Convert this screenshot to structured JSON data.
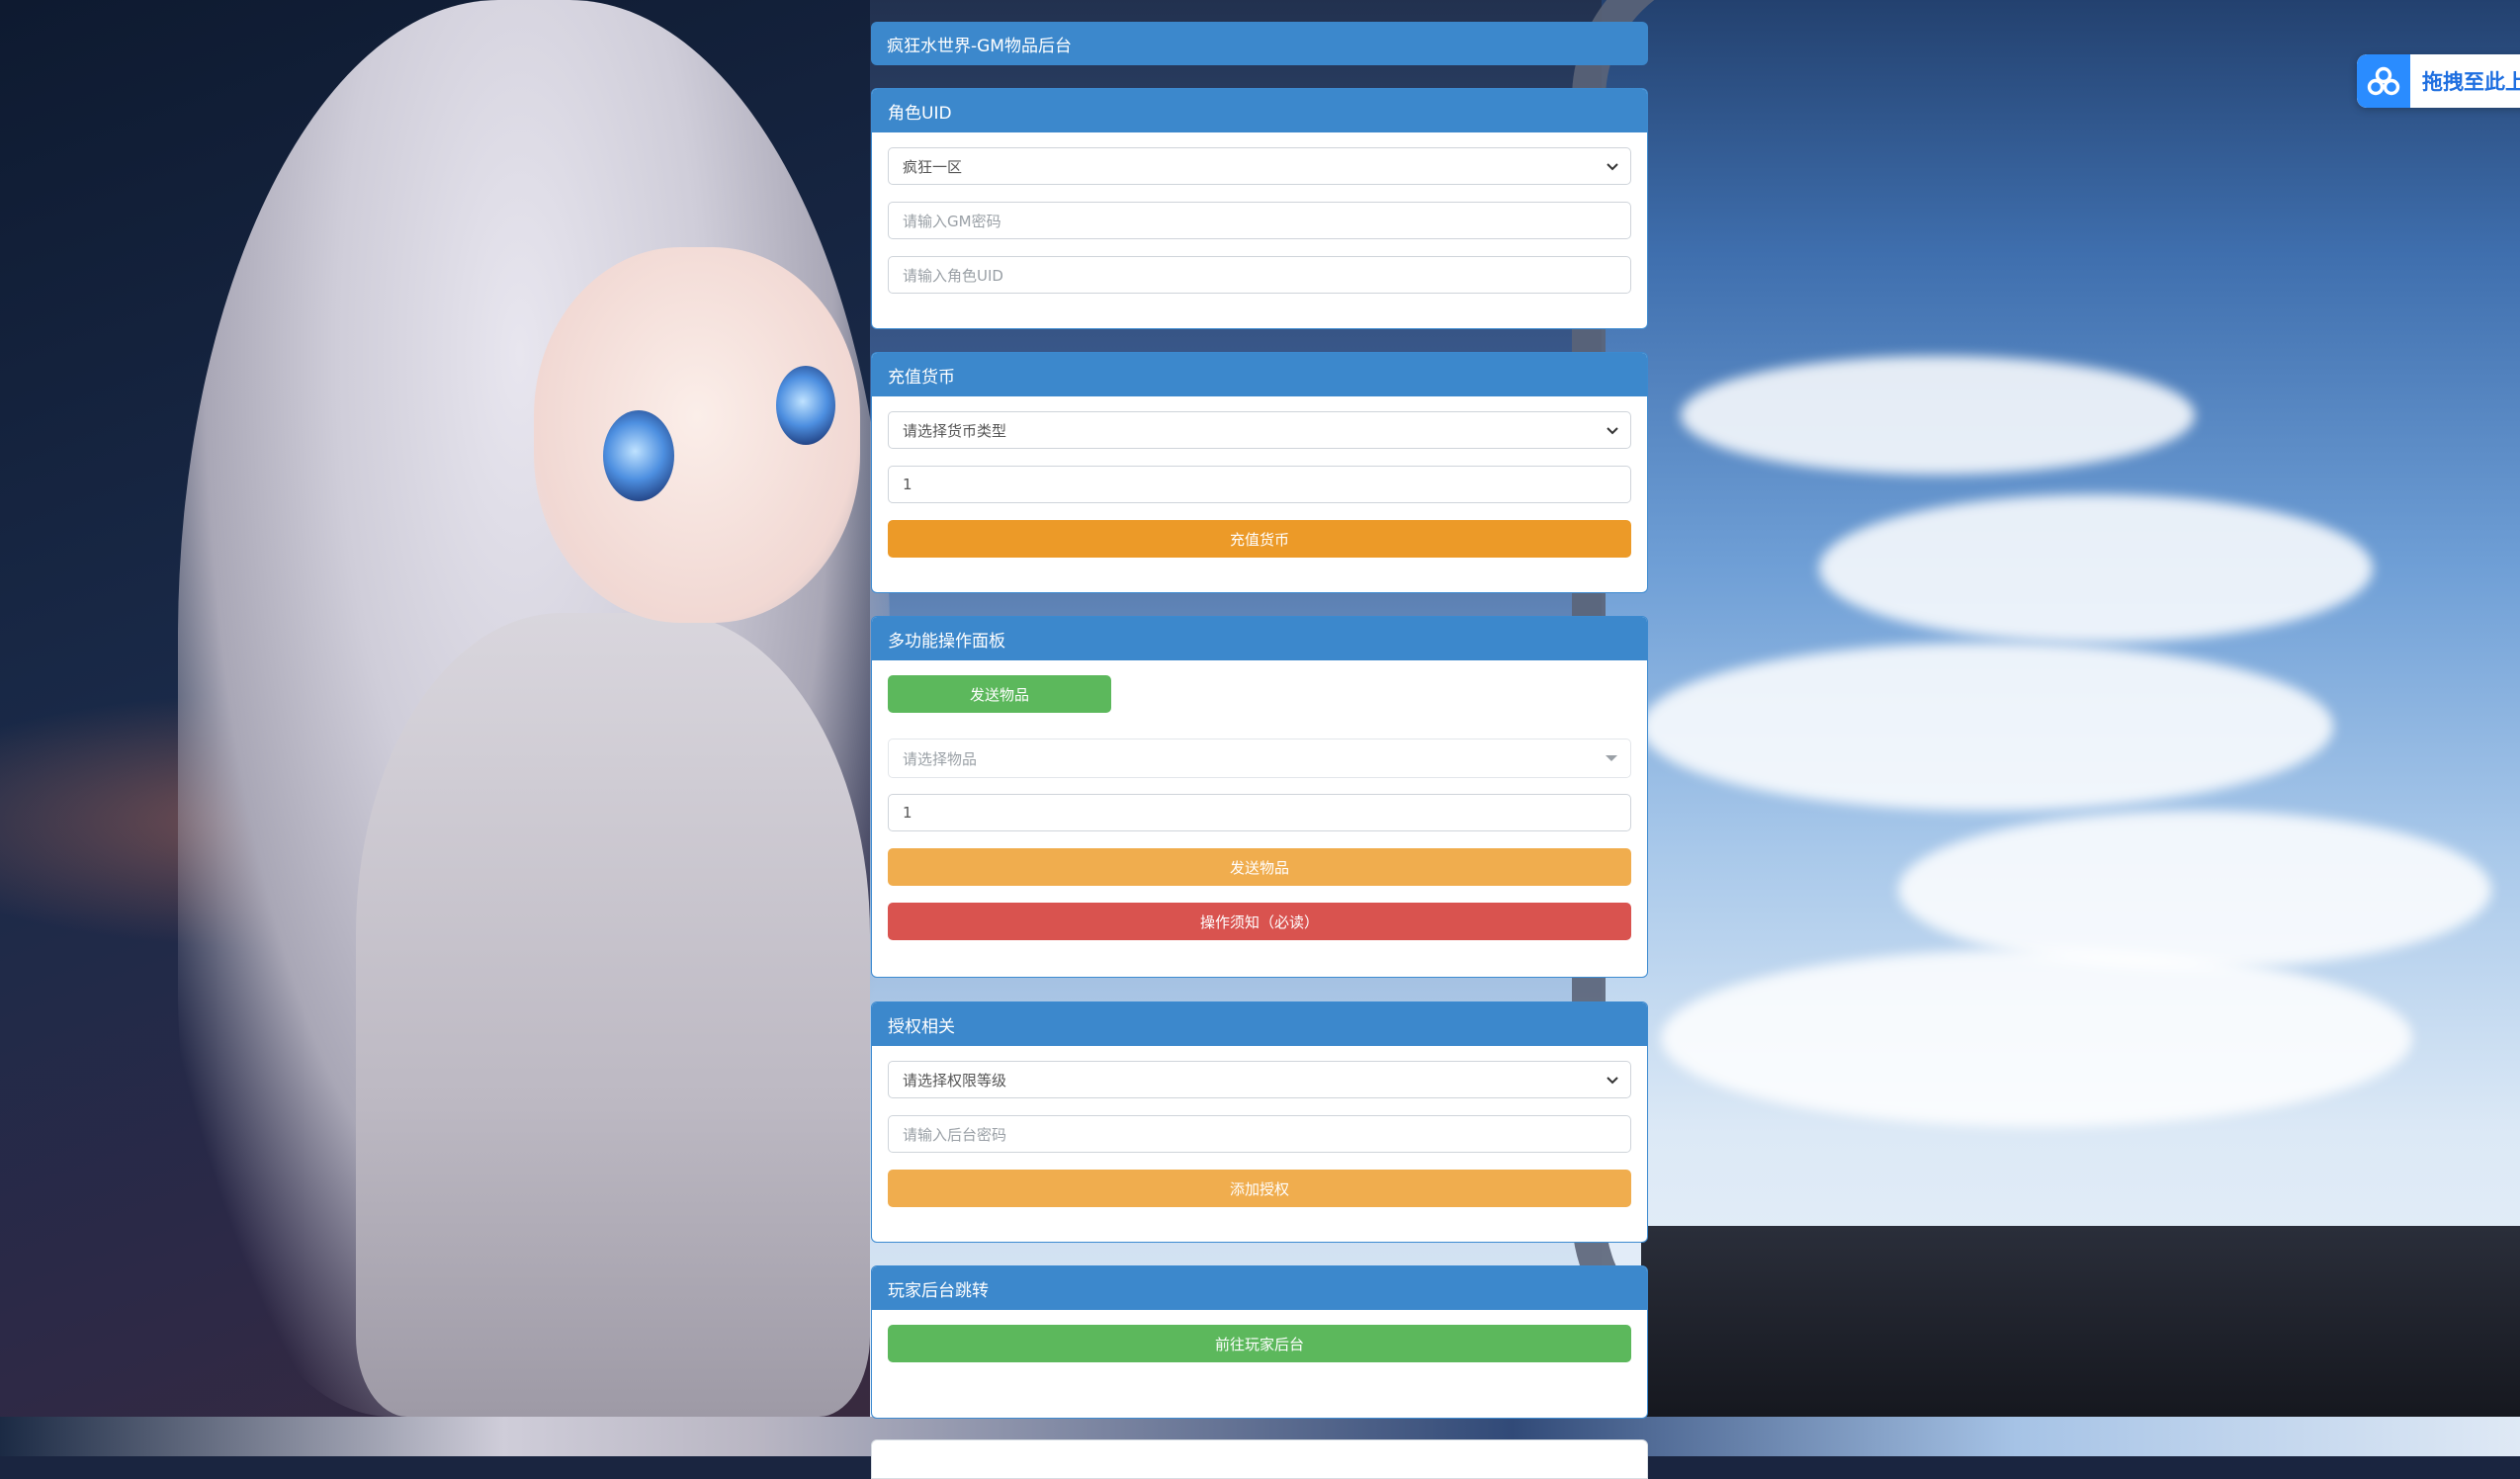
{
  "header": {
    "title": "疯狂水世界-GM物品后台"
  },
  "side_widget": {
    "label": "拖拽至此上"
  },
  "role": {
    "title": "角色UID",
    "server_selected": "疯狂一区",
    "gm_password_placeholder": "请输入GM密码",
    "uid_placeholder": "请输入角色UID"
  },
  "currency": {
    "title": "充值货币",
    "type_selected": "请选择货币类型",
    "amount_value": "1",
    "submit_label": "充值货币"
  },
  "multi": {
    "title": "多功能操作面板",
    "tab_label": "发送物品",
    "item_placeholder": "请选择物品",
    "quantity_value": "1",
    "send_label": "发送物品",
    "notice_label": "操作须知（必读）"
  },
  "auth": {
    "title": "授权相关",
    "level_selected": "请选择权限等级",
    "password_placeholder": "请输入后台密码",
    "add_label": "添加授权"
  },
  "player": {
    "title": "玩家后台跳转",
    "go_label": "前往玩家后台"
  },
  "colors": {
    "panel_header": "#3c88cc",
    "orange": "#ec9a28",
    "orange_light": "#f0ad4e",
    "red": "#d9534f",
    "green": "#5cb85c",
    "baidu_blue": "#2a8cff"
  }
}
